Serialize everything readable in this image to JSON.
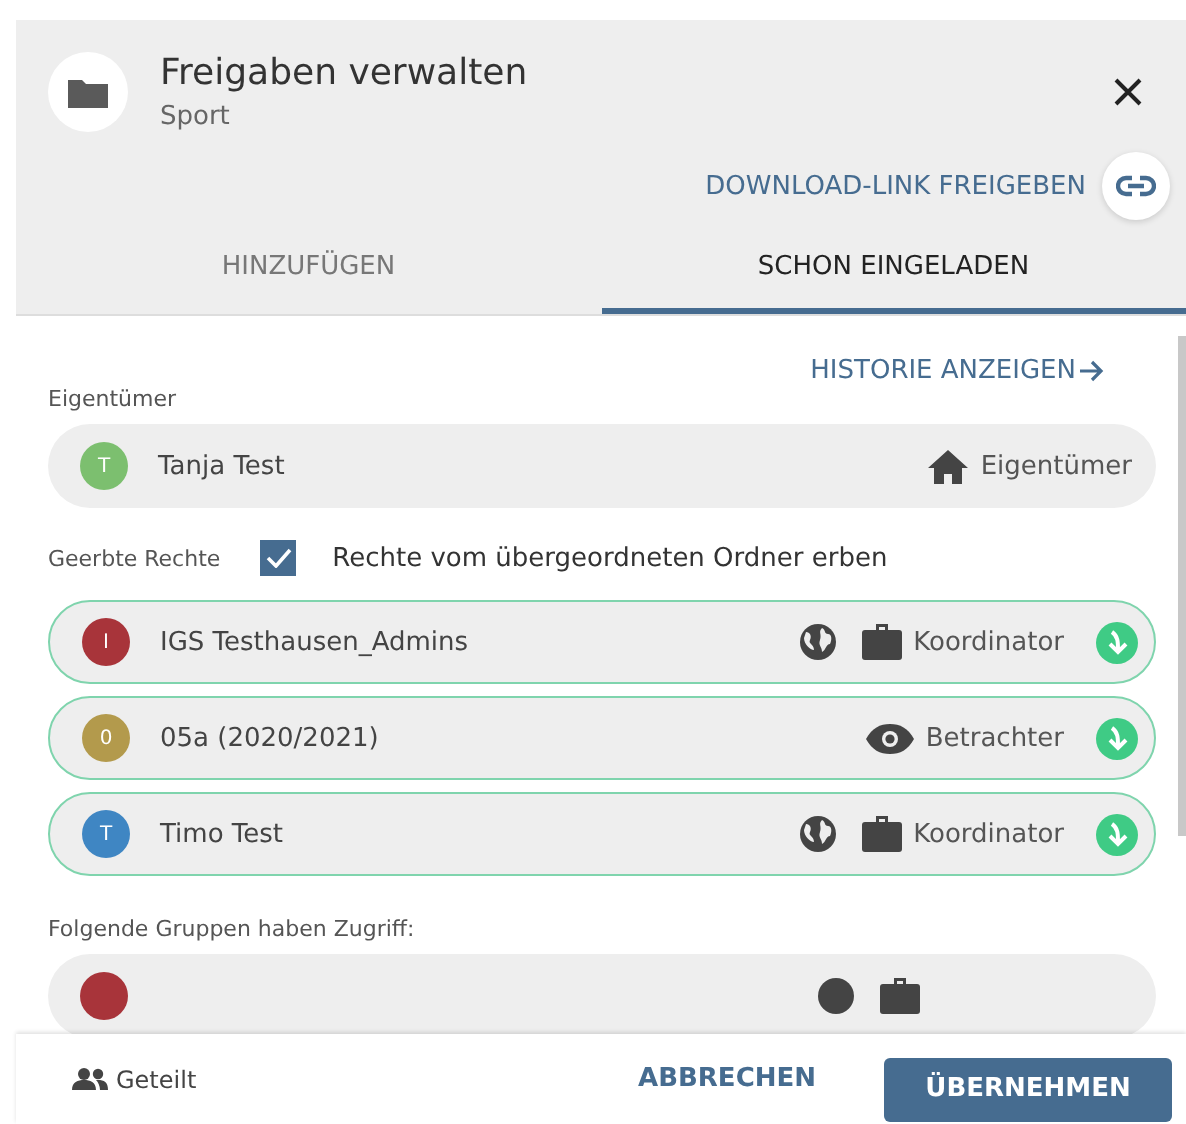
{
  "header": {
    "title": "Freigaben verwalten",
    "subtitle": "Sport",
    "download_link": "DOWNLOAD-LINK FREIGEBEN"
  },
  "tabs": [
    {
      "label": "HINZUFÜGEN",
      "selected": false
    },
    {
      "label": "SCHON EINGELADEN",
      "selected": true
    }
  ],
  "history_link": "HISTORIE ANZEIGEN",
  "owner": {
    "label": "Eigentümer",
    "initial": "T",
    "name": "Tanja Test",
    "color": "#7cbf6f",
    "role": "Eigentümer"
  },
  "inherited": {
    "label": "Geerbte Rechte",
    "checkbox": {
      "checked": true,
      "label": "Rechte vom übergeordneten Ordner erben"
    },
    "members": [
      {
        "initial": "I",
        "name": "IGS Testhausen_Admins",
        "color": "#a8343a",
        "kind": "coordinator",
        "role": "Koordinator"
      },
      {
        "initial": "0",
        "name": "05a (2020/2021)",
        "color": "#b39a4c",
        "kind": "viewer",
        "role": "Betrachter"
      },
      {
        "initial": "T",
        "name": "Timo Test",
        "color": "#3f86c3",
        "kind": "coordinator",
        "role": "Koordinator"
      }
    ]
  },
  "groups": {
    "label": "Folgende Gruppen haben Zugriff:",
    "members": [
      {
        "color": "#a8343a",
        "kind": "coordinator"
      }
    ]
  },
  "footer": {
    "shared": "Geteilt",
    "cancel": "ABBRECHEN",
    "apply": "ÜBERNEHMEN"
  }
}
